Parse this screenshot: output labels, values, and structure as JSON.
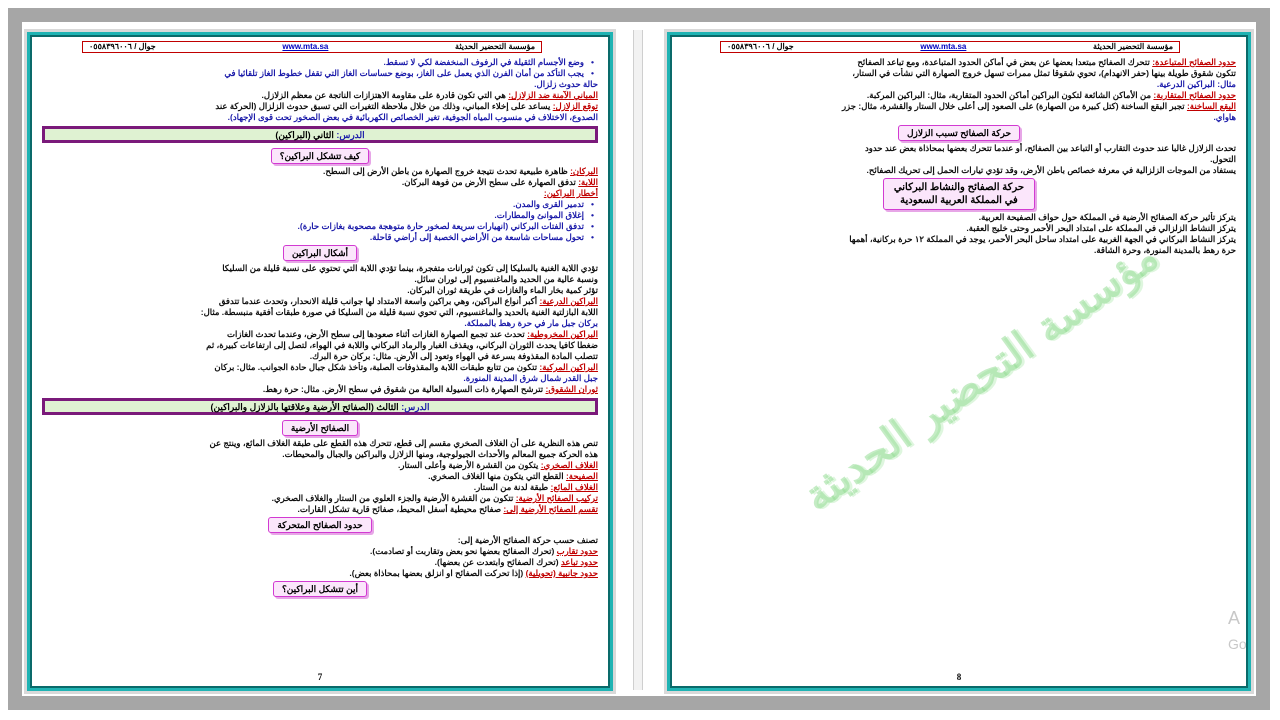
{
  "header": {
    "org": "مؤسسة التحضير الحديثة",
    "web": "www.mta.sa",
    "phone": "جوال / ٠٥٥٨٣٩٦٠٠٦"
  },
  "left": {
    "page_number": "7",
    "lines": [
      {
        "text": "وضع الأجسام الثقيلة في الرفوف المنخفضة لكي لا تسقط.",
        "cls": "bul blue"
      },
      {
        "text": "يجب التأكد من أمان الفرن الذي يعمل على الغاز، بوضع حساسات الغاز التي تقفل خطوط الغاز تلقائيا في",
        "cls": "bul blue"
      },
      {
        "text": "حالة حدوث زلزال.",
        "cls": "blue"
      },
      {
        "label": "المباني الآمنة ضد الزلازل:",
        "text": " هي التي تكون قادرة على مقاومة الاهتزازات الناتجة عن معظم الزلازل."
      },
      {
        "label": "توقع الزلازل:",
        "text": " يساعد على إخلاء المباني، وذلك من خلال ملاحظة التغيرات التي تسبق حدوث الزلزال (الحركة عند"
      },
      {
        "text": "الصدوع، الاختلاف في منسوب المياه الجوفية، تغير الخصائص الكهربائية في بعض الصخور تحت قوى الإجهاد).",
        "cls": "blue"
      }
    ],
    "lesson2": {
      "label": "الدرس:",
      "title": "الثاني (البراكين)"
    },
    "chip_how": "كيف تتشكل البراكين؟",
    "lines2": [
      {
        "label": "البركان:",
        "text": " ظاهرة طبيعية تحدث نتيجة خروج الصهارة من باطن الأرض إلى السطح."
      },
      {
        "label": "اللابة:",
        "text": " تدفق الصهارة على سطح الأرض من فوهة البركان."
      },
      {
        "label": "أخطار البراكين:",
        "text": ""
      },
      {
        "text": "تدمير القرى والمدن.",
        "cls": "bul blue"
      },
      {
        "text": "إغلاق الموانئ والمطارات.",
        "cls": "bul blue"
      },
      {
        "text": "تدفق الفتات البركاني (انهيارات سريعة لصخور حارة متوهجة مصحوبة بغازات حارة).",
        "cls": "bul blue"
      },
      {
        "text": "تحول مساحات شاسعة من الأراضي الخصبة إلى أراضي قاحلة.",
        "cls": "bul blue"
      }
    ],
    "chip_shapes": "أشكال البراكين",
    "lines3": [
      {
        "text": "تؤدي اللابة الغنية بالسليكا إلى تكون ثورانات متفجرة، بينما تؤدي اللابة التي تحتوي على نسبة قليلة من السليكا"
      },
      {
        "text": "ونسبة عالية من الحديد والماغنسيوم إلى ثوران سائل."
      },
      {
        "text": "تؤثر كمية بخار الماء والغازات في طريقة ثوران البركان."
      },
      {
        "label": "البراكين الدرعية:",
        "text": " أكبر أنواع البراكين، وهي براكين واسعة الامتداد لها جوانب قليلة الانحدار، وتحدث عندما تتدفق"
      },
      {
        "text": "اللابة البازلتية الغنية بالحديد والماغنسيوم، التي تحوي نسبة قليلة من السليكا في صورة طبقات أفقية منبسطة. مثال:"
      },
      {
        "text": "بركان جبل مار في حرة رهط بالمملكة.",
        "cls": "blue"
      },
      {
        "label": "البراكين المخروطية:",
        "text": " تحدث عند تجمع الصهارة الغازات أثناء صعودها إلى سطح الأرض، وعندما تحدث الغازات"
      },
      {
        "text": "ضغطا كافيا يحدث الثوران البركاني، ويقذف الغبار والرماد البركاني واللابة في الهواء، لتصل إلى ارتفاعات كبيرة، ثم"
      },
      {
        "text": "تتصلب المادة المقذوفة بسرعة في الهواء وتعود إلى الأرض. مثال: بركان حرة البرك."
      },
      {
        "label": "البراكين المركبة:",
        "text": " تتكون من تتابع طبقات اللابة والمقذوفات الصلبة، وتأخذ شكل جبال حادة الجوانب. مثال: بركان"
      },
      {
        "text": "جبل القدر شمال شرق المدينة المنورة.",
        "cls": "blue"
      },
      {
        "label": "ثوران الشقوق:",
        "text": " تترشح الصهارة ذات السيولة العالية من شقوق في سطح الأرض. مثال: حرة رهط."
      }
    ],
    "lesson3": {
      "label": "الدرس:",
      "title": "الثالث (الصفائح الأرضية وعلاقتها بالزلازل والبراكين)"
    },
    "chip_plates": "الصفائح الأرضية",
    "lines4": [
      {
        "text": "تنص هذه النظرية على أن الغلاف الصخري مقسم إلى قطع، تتحرك هذه القطع على طبقة الغلاف المائع، وينتج عن"
      },
      {
        "text": "هذه الحركة جميع المعالم والأحداث الجيولوجية، ومنها الزلازل والبراكين والجبال والمحيطات."
      },
      {
        "label": "الغلاف الصخري:",
        "text": " يتكون من القشرة الأرضية وأعلى الستار."
      },
      {
        "label": "الصفيحة:",
        "text": " القطع التي يتكون منها الغلاف الصخري."
      },
      {
        "label": "الغلاف المائع:",
        "text": " طبقة لدنة من الستار."
      },
      {
        "label": "تركيب الصفائح الأرضية:",
        "text": " تتكون من القشرة الأرضية والجزء العلوي من الستار والغلاف الصخري."
      },
      {
        "label": "تقسم الصفائح الأرضية إلى:",
        "text": " صفائح محيطية أسفل المحيط، صفائح قارية تشكل القارات."
      }
    ],
    "chip_bounds": "حدود الصفائح المتحركة",
    "lines5": [
      {
        "text": "تصنف حسب حركة الصفائح الأرضية إلى:"
      },
      {
        "label": "حدود تقارب",
        "text": " (تحرك الصفائح بعضها نحو بعض وتقاربت أو تصادمت)."
      },
      {
        "label": "حدود تباعد",
        "text": " (تحرك الصفائح وابتعدت عن بعضها)."
      },
      {
        "label": "حدود جانبية (تحويلية)",
        "text": " (إذا تحركت الصفائح او انزلق بعضها بمحاذاة بعض)."
      }
    ],
    "chip_where": "أين تتشكل البراكين؟"
  },
  "right": {
    "page_number": "8",
    "lines": [
      {
        "label": "حدود الصفائح المتباعدة:",
        "text": " تتحرك الصفائح مبتعدا بعضها عن بعض في أماكن الحدود المتباعدة، ومع تباعد الصفائح"
      },
      {
        "text": "تتكون شقوق طويلة بينها (حفر الانهدام)، تحوي شقوقا تمثل ممرات تسهل خروج الصهارة التي نشأت في الستار،"
      },
      {
        "text": "مثال: البراكين الدرعية.",
        "cls": "blue"
      },
      {
        "label": "حدود الصفائح المتقاربة:",
        "text": " من الأماكن الشائعة لتكون البراكين أماكن الحدود المتقاربة، مثال: البراكين المركبة."
      },
      {
        "label": "البقع الساخنة:",
        "text": " تجبر البقع الساخنة (كتل كبيرة من الصهارة) على الصعود إلى أعلى خلال الستار والقشرة، مثال: جزر"
      },
      {
        "text": "هاواي.",
        "cls": "blue"
      }
    ],
    "chip_move": "حركة الصفائح تسبب الزلازل",
    "lines2": [
      {
        "text": "تحدث الزلازل غالبا عند حدوث التقارب أو التباعد بين الصفائح، أو عندما تتحرك بعضها بمحاذاة بعض عند حدود"
      },
      {
        "text": "التحول."
      },
      {
        "text": "يستفاد من الموجات الزلزالية في معرفة خصائص باطن الأرض، وقد تؤدي تيارات الحمل إلى تحريك الصفائح."
      }
    ],
    "chip_saudi": [
      "حركة الصفائح والنشاط البركاني",
      "في المملكة العربية السعودية"
    ],
    "lines3": [
      {
        "text": "يتركز تأثير حركة الصفائح الأرضية في المملكة حول حواف الصفيحة العربية."
      },
      {
        "text": "يتركز النشاط الزلزالي في المملكة على امتداد البحر الأحمر وحتى خليج العقبة."
      },
      {
        "text": "يتركز النشاط البركاني في الجهة الغربية على امتداد ساحل البحر الأحمر، يوجد في المملكة ١٢ حرة بركانية، أهمها"
      },
      {
        "text": "حرة رهط بالمدينة المنورة، وحرة الشاقة."
      }
    ],
    "watermark": "مؤسسة التحضير الحديثة"
  },
  "overlay": {
    "line1": "A",
    "line2": "Go"
  }
}
